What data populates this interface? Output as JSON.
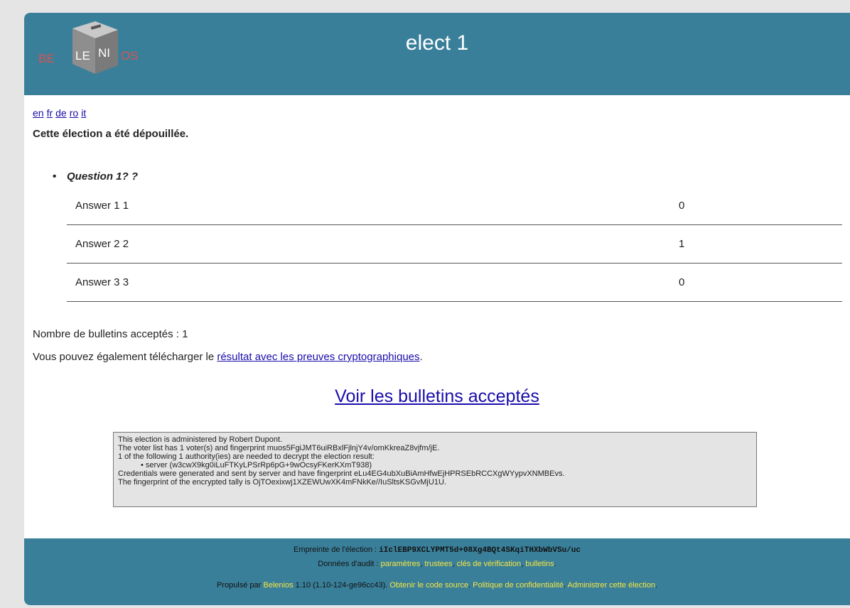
{
  "header": {
    "title": "elect 1",
    "logo_text_left": "BE",
    "logo_text_mid1": "LE",
    "logo_text_mid2": "NI",
    "logo_text_right": "OS"
  },
  "languages": [
    "en",
    "fr",
    "de",
    "ro",
    "it"
  ],
  "status": "Cette élection a été dépouillée.",
  "question": {
    "label": "Question 1? ?",
    "answers": [
      {
        "label": "Answer 1 1",
        "count": "0"
      },
      {
        "label": "Answer 2 2",
        "count": "1"
      },
      {
        "label": "Answer 3 3",
        "count": "0"
      }
    ]
  },
  "accepted_text": "Nombre de bulletins acceptés : 1",
  "download": {
    "prefix": "Vous pouvez également télécharger le ",
    "link": "résultat avec les preuves cryptographiques",
    "suffix": "."
  },
  "view_link": "Voir les bulletins acceptés",
  "audit": {
    "line1": "This election is administered by Robert Dupont.",
    "line2": "The voter list has 1 voter(s) and fingerprint muos5FgiJMT6uiRBxlFjlnjY4v/omKkreaZ8vjfm/jE.",
    "line3": "1 of the following 1 authority(ies) are needed to decrypt the election result:",
    "line4": "• server (w3cwX9kg0iLuFTKyLPSrRp6pG+9wOcsyFKerKXmT938)",
    "line5": "Credentials were generated and sent by server and have fingerprint eLu4EG4ubXuBiAmHfwEjHPRSEbRCCXgWYypvXNMBEvs.",
    "line6": "The fingerprint of the encrypted tally is OjTOexixwj1XZEWUwXK4mFNkKe//IuSltsKSGvMjU1U."
  },
  "footer": {
    "fingerprint_label": "Empreinte de l'élection : ",
    "fingerprint_value": "iIclEBP9XCLYPMT5d+08Xg4BQt4SKqiTHXbWbVSu/uc",
    "audit_label": "Données d'audit : ",
    "audit_links": [
      "paramètres",
      "trustees",
      "clés de vérification",
      "bulletins"
    ],
    "powered_label": "Propulsé par ",
    "belenios_link": "Belenios",
    "version": " 1.10 (1.10-124-ge96cc43). ",
    "source_link": "Obtenir le code source",
    "privacy_link": "Politique de confidentialité",
    "admin_link": "Administrer cette élection"
  },
  "colors": {
    "header_bg": "#3a7f99",
    "link": "#1a0dab",
    "footer_link": "#f5e642"
  }
}
